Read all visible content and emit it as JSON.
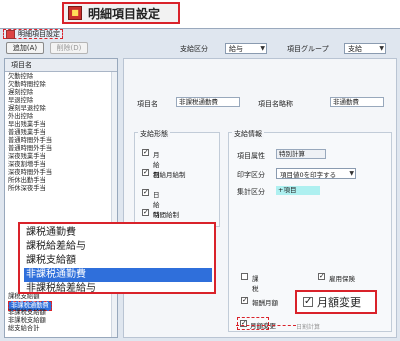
{
  "title_banner": {
    "icon": "app-icon",
    "text": "明細項目設定"
  },
  "window": {
    "title": "明細項目設定"
  },
  "toolbar": {
    "add_label": "追加(A)",
    "delete_label": "削除(D)",
    "pay_type_label": "支給区分",
    "pay_type_value": "給与",
    "item_group_label": "項目グループ",
    "item_group_value": "支給"
  },
  "list": {
    "header": "項目名",
    "items": [
      "欠勤控除",
      "欠勤時間控除",
      "遅刻控除",
      "早退控除",
      "遅刻早退控除",
      "外出控除",
      "早出残業手当",
      "普通残業手当",
      "普通時間外手当",
      "普通時間外手当",
      "深夜残業手当",
      "深夜割増手当",
      "深夜時間外手当",
      "所休出勤手当",
      "所休深夜手当"
    ],
    "bottom_items": [
      "課税支給額",
      "非課税通勤費",
      "非課税支給額",
      "非課税支給額",
      "総支給合計"
    ],
    "highlight_bottom_index": 1
  },
  "popup": {
    "items": [
      "課税通勤費",
      "課税給差給与",
      "課税支給額",
      "非課税通勤費",
      "非課税給差給与"
    ],
    "selected_index": 3
  },
  "detail": {
    "item_name_label": "項目名",
    "item_name_value": "非課税通勤費",
    "abbrev_label": "項目名略称",
    "abbrev_value": "非通勤費",
    "pay_form_title": "支給形態",
    "pay_forms": [
      {
        "label": "月給制",
        "checked": true
      },
      {
        "label": "日給月給制",
        "checked": true
      },
      {
        "label": "日給制",
        "checked": true
      },
      {
        "label": "時間給制",
        "checked": true
      }
    ],
    "pay_info_title": "支給情報",
    "attribute_label": "項目属性",
    "attribute_value": "特別計算",
    "print_label": "印字区分",
    "print_value": "項目値0を印字する",
    "total_label": "集計区分",
    "total_value": "+項目",
    "taxable_label": "課税",
    "taxable_checked": false,
    "employment_ins_label": "雇用保険",
    "employment_ins_checked": true,
    "wage_label": "報酬月額",
    "wage_checked": true,
    "monthly_change_label": "月額変更",
    "monthly_change_checked": true,
    "daily_label": "日割計算",
    "monthly_change_callout": "月額変更"
  }
}
